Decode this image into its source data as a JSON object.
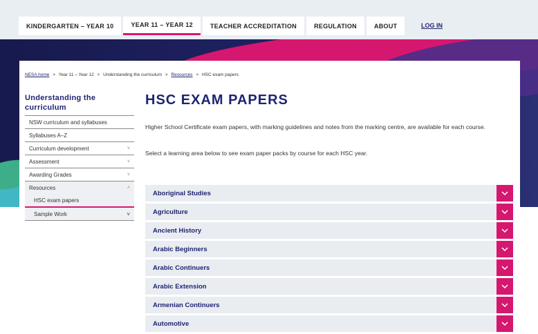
{
  "nav": {
    "items": [
      {
        "label": "KINDERGARTEN – YEAR 10"
      },
      {
        "label": "YEAR 11 – YEAR 12"
      },
      {
        "label": "TEACHER ACCREDITATION"
      },
      {
        "label": "REGULATION"
      },
      {
        "label": "ABOUT"
      }
    ],
    "login": "LOG IN"
  },
  "breadcrumb": {
    "home": "NESA home",
    "year": "Year 11 – Year 12",
    "curriculum": "Understanding the curriculum",
    "resources": "Resources",
    "current": "HSC exam papers",
    "sep": ">"
  },
  "sidebar": {
    "title": "Understanding the curriculum",
    "items": [
      {
        "label": "NSW curriculum and syllabuses",
        "chevron": ""
      },
      {
        "label": "Syllabuses A–Z",
        "chevron": ""
      },
      {
        "label": "Curriculum development",
        "chevron": "˅"
      },
      {
        "label": "Assessment",
        "chevron": "˅"
      },
      {
        "label": "Awarding Grades",
        "chevron": "˅"
      },
      {
        "label": "Resources",
        "chevron": "˄"
      }
    ],
    "sub": [
      {
        "label": "HSC exam papers",
        "chevron": ""
      },
      {
        "label": "Sample Work",
        "chevron": "˅"
      }
    ]
  },
  "main": {
    "title": "HSC EXAM PAPERS",
    "intro": "Higher School Certificate exam papers, with marking guidelines and notes from the marking centre, are available for each course.",
    "select": "Select a learning area below to see exam paper packs by course for each HSC year."
  },
  "accordion": [
    {
      "label": "Aboriginal Studies"
    },
    {
      "label": "Agriculture"
    },
    {
      "label": "Ancient History"
    },
    {
      "label": "Arabic Beginners"
    },
    {
      "label": "Arabic Continuers"
    },
    {
      "label": "Arabic Extension"
    },
    {
      "label": "Armenian Continuers"
    },
    {
      "label": "Automotive"
    }
  ],
  "colors": {
    "accent": "#d6176f",
    "brand": "#1f2470"
  }
}
